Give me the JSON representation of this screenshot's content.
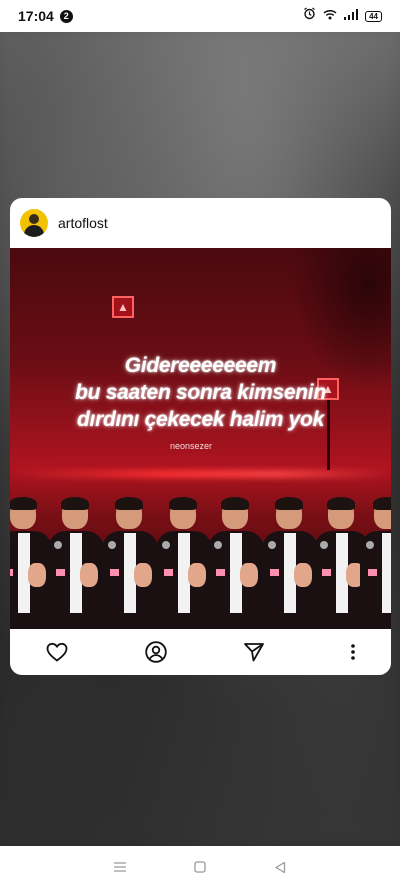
{
  "status_bar": {
    "time": "17:04",
    "notification_count": "2",
    "battery": "44"
  },
  "post": {
    "username": "artoflost",
    "overlay_text_lines": [
      "Gidereeeeeeem",
      "bu saaten sonra kimsenin",
      "dırdını çekecek halim yok"
    ],
    "watermark": "neonsezer"
  },
  "actions": {
    "icons": [
      "heart-icon",
      "profile-icon",
      "send-icon",
      "more-vertical-icon"
    ]
  },
  "nav": {
    "icons": [
      "menu-icon",
      "home-square-icon",
      "back-triangle-icon"
    ]
  },
  "colors": {
    "card_bg": "#ffffff",
    "image_red": "#b01420"
  }
}
